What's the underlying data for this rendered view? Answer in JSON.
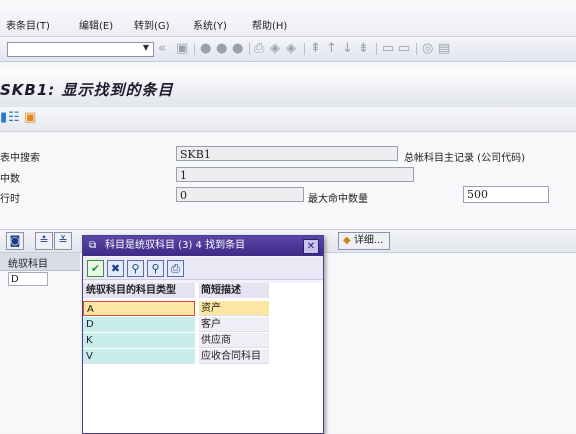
{
  "menu": [
    "表条目(T)",
    "编辑(E)",
    "转到(G)",
    "系统(Y)",
    "帮助(H)"
  ],
  "title": "SKB1: 显示找到的条目",
  "form": {
    "search_label": "表中搜索",
    "search_value": "SKB1",
    "search_desc": "总帐科目主记录 (公司代码)",
    "hits_label": "中数",
    "hits_value": "1",
    "runtime_label": "行时",
    "runtime_value": "0",
    "max_label": "最大命中数量",
    "max_value": "500"
  },
  "alv": {
    "detail_label": "详细...",
    "column_header": "统驭科目",
    "cell_value": "D"
  },
  "popup": {
    "title": "科目是统驭科目 (3)   4 找到条目",
    "col1": "统驭科目的科目类型",
    "col2": "简短描述",
    "rows": [
      {
        "code": "A",
        "desc": "资产"
      },
      {
        "code": "D",
        "desc": "客户"
      },
      {
        "code": "K",
        "desc": "供应商"
      },
      {
        "code": "V",
        "desc": "应收合同科目"
      }
    ]
  },
  "colors": {
    "popup_title_bg": "#4a36a0",
    "selected_row": "#fde5a2",
    "row_code_bg": "#c7ecec"
  }
}
